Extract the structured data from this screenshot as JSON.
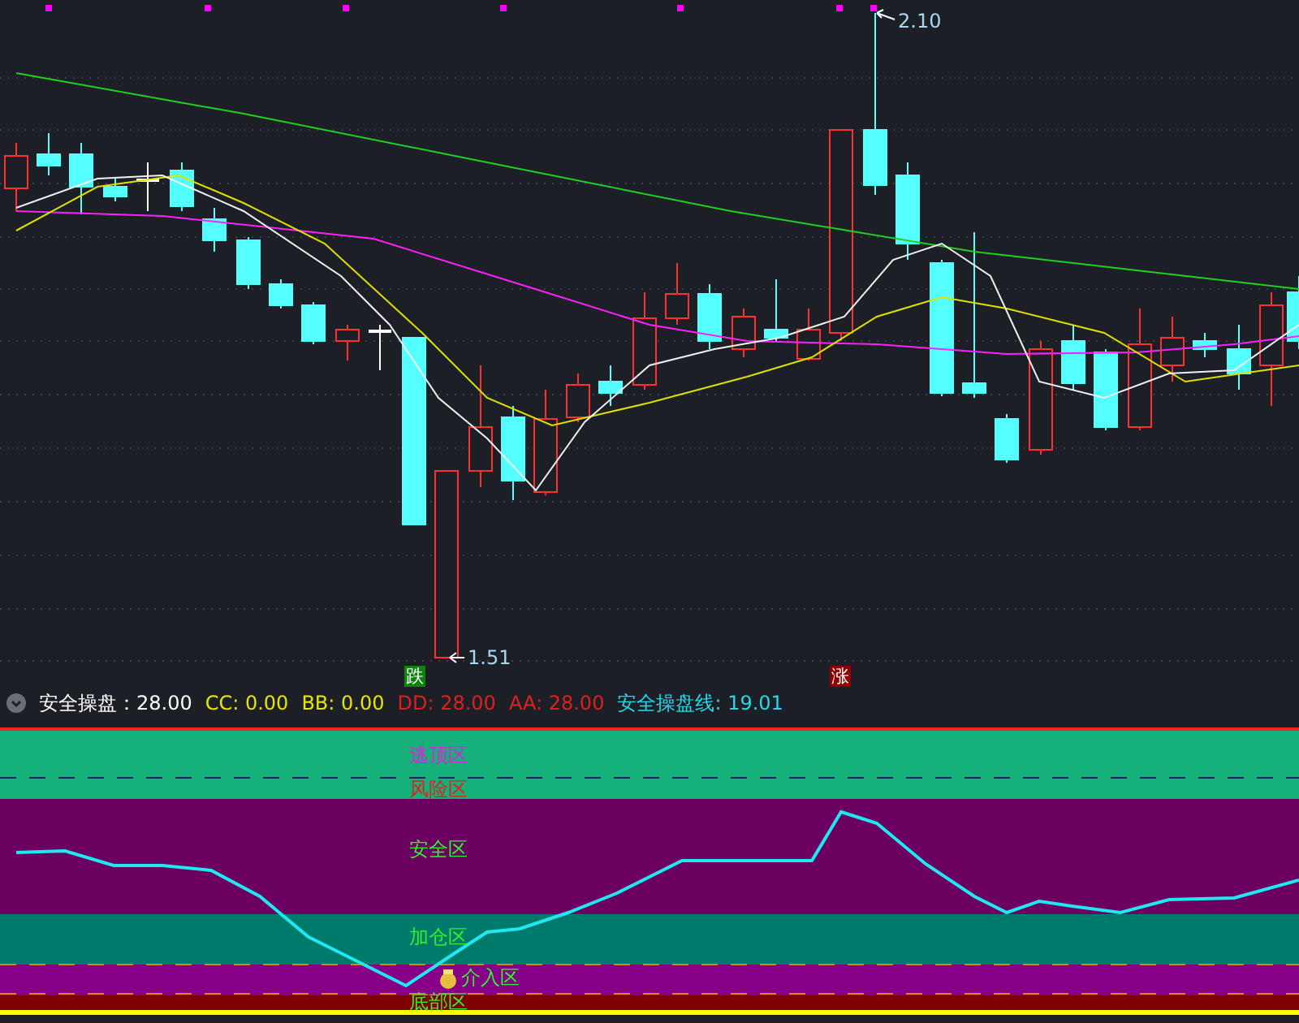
{
  "main_chart": {
    "high_label": "2.10",
    "low_label": "1.51",
    "markers": [
      {
        "text": "跌",
        "kind": "down"
      },
      {
        "text": "涨",
        "kind": "up"
      }
    ]
  },
  "indicator": {
    "items": [
      {
        "text": "安全操盘：28.00",
        "color": "#ffffff"
      },
      {
        "text": "CC: 0.00",
        "color": "#e6e600"
      },
      {
        "text": "BB: 0.00",
        "color": "#e6e600"
      },
      {
        "text": "DD: 28.00",
        "color": "#e02020"
      },
      {
        "text": "AA: 28.00",
        "color": "#e02020"
      },
      {
        "text": "安全操盘线: 19.01",
        "color": "#28d8e8"
      }
    ]
  },
  "zones": [
    {
      "label": "逃顶区",
      "color": "#e020e0"
    },
    {
      "label": "风险区",
      "color": "#e02020"
    },
    {
      "label": "安全区",
      "color": "#30f030"
    },
    {
      "label": "加仓区",
      "color": "#30f030"
    },
    {
      "label": "介入区",
      "color": "#30f030"
    },
    {
      "label": "底部区",
      "color": "#30f030"
    }
  ]
}
